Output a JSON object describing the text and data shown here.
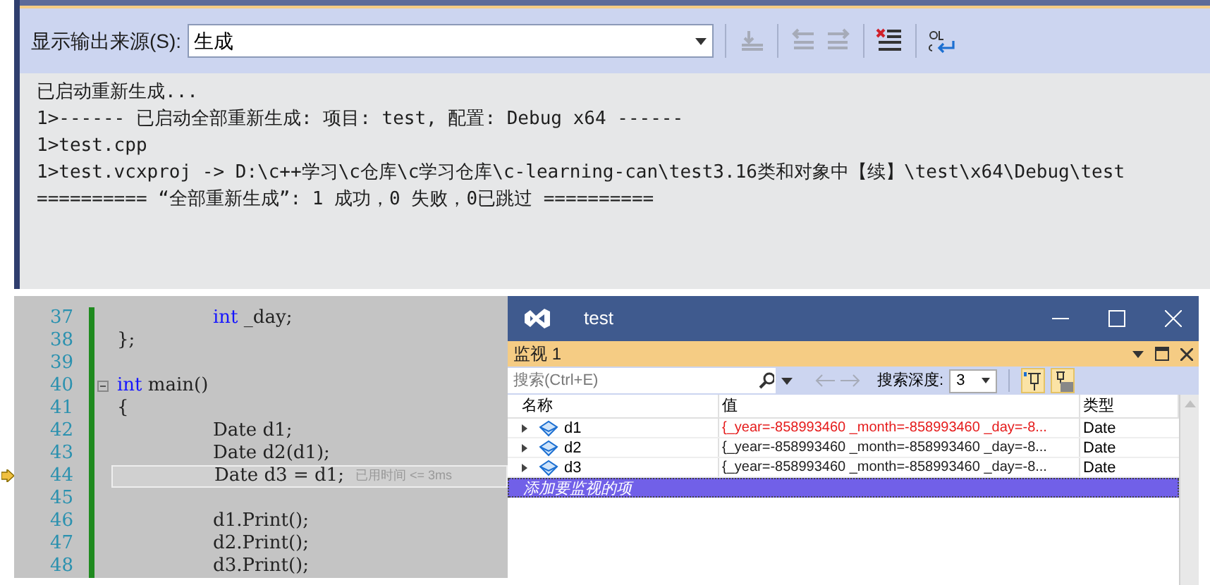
{
  "output_panel": {
    "source_label": "显示输出来源(S):",
    "source_value": "生成",
    "lines": [
      "已启动重新生成...",
      "1>------ 已启动全部重新生成: 项目: test, 配置: Debug x64 ------",
      "1>test.cpp",
      "1>test.vcxproj -> D:\\c++学习\\c仓库\\c学习仓库\\c-learning-can\\test3.16类和对象中【续】\\test\\x64\\Debug\\test",
      "========== “全部重新生成”: 1 成功，0 失败，0已跳过 =========="
    ]
  },
  "editor": {
    "lines": [
      {
        "number": "37",
        "segments": [
          {
            "kind": "keyword",
            "text": "int"
          },
          {
            "kind": "plain",
            "text": " _day;"
          }
        ],
        "current": false
      },
      {
        "number": "38",
        "segments": [
          {
            "kind": "plain",
            "text": "};"
          }
        ],
        "current": false
      },
      {
        "number": "39",
        "current": false
      },
      {
        "number": "40",
        "segments": [
          {
            "kind": "keyword",
            "text": "int"
          },
          {
            "kind": "plain",
            "text": " main()"
          }
        ],
        "current": false,
        "collapsible": true
      },
      {
        "number": "41",
        "segments": [
          {
            "kind": "plain",
            "text": "{"
          }
        ],
        "current": false
      },
      {
        "number": "42",
        "segments": [
          {
            "kind": "plain",
            "text": "Date d1;"
          }
        ],
        "current": false
      },
      {
        "number": "43",
        "segments": [
          {
            "kind": "plain",
            "text": "Date d2(d1);"
          }
        ],
        "current": false
      },
      {
        "number": "44",
        "segments": [
          {
            "kind": "plain",
            "text": "Date d3 = d1;"
          }
        ],
        "current": true,
        "hint": "已用时间 <= 3ms"
      },
      {
        "number": "45",
        "current": false
      },
      {
        "number": "46",
        "segments": [
          {
            "kind": "plain",
            "text": "d1.Print();"
          }
        ],
        "current": false
      },
      {
        "number": "47",
        "segments": [
          {
            "kind": "plain",
            "text": "d2.Print();"
          }
        ],
        "current": false
      },
      {
        "number": "48",
        "segments": [
          {
            "kind": "plain",
            "text": "d3.Print();"
          }
        ],
        "current": false
      }
    ]
  },
  "watch_window": {
    "title": "test",
    "panel_title": "监视 1",
    "search": {
      "placeholder": "搜索(Ctrl+E)"
    },
    "depth_label": "搜索深度:",
    "depth_value": "3",
    "columns": [
      "名称",
      "值",
      "类型"
    ],
    "rows": [
      {
        "name": "d1",
        "value": "{_year=-858993460 _month=-858993460 _day=-8...",
        "type": "Date",
        "changed": true
      },
      {
        "name": "d2",
        "value": "{_year=-858993460 _month=-858993460 _day=-8...",
        "type": "Date",
        "changed": false
      },
      {
        "name": "d3",
        "value": "{_year=-858993460 _month=-858993460 _day=-8...",
        "type": "Date",
        "changed": false
      }
    ],
    "add_row": "添加要监视的项"
  }
}
